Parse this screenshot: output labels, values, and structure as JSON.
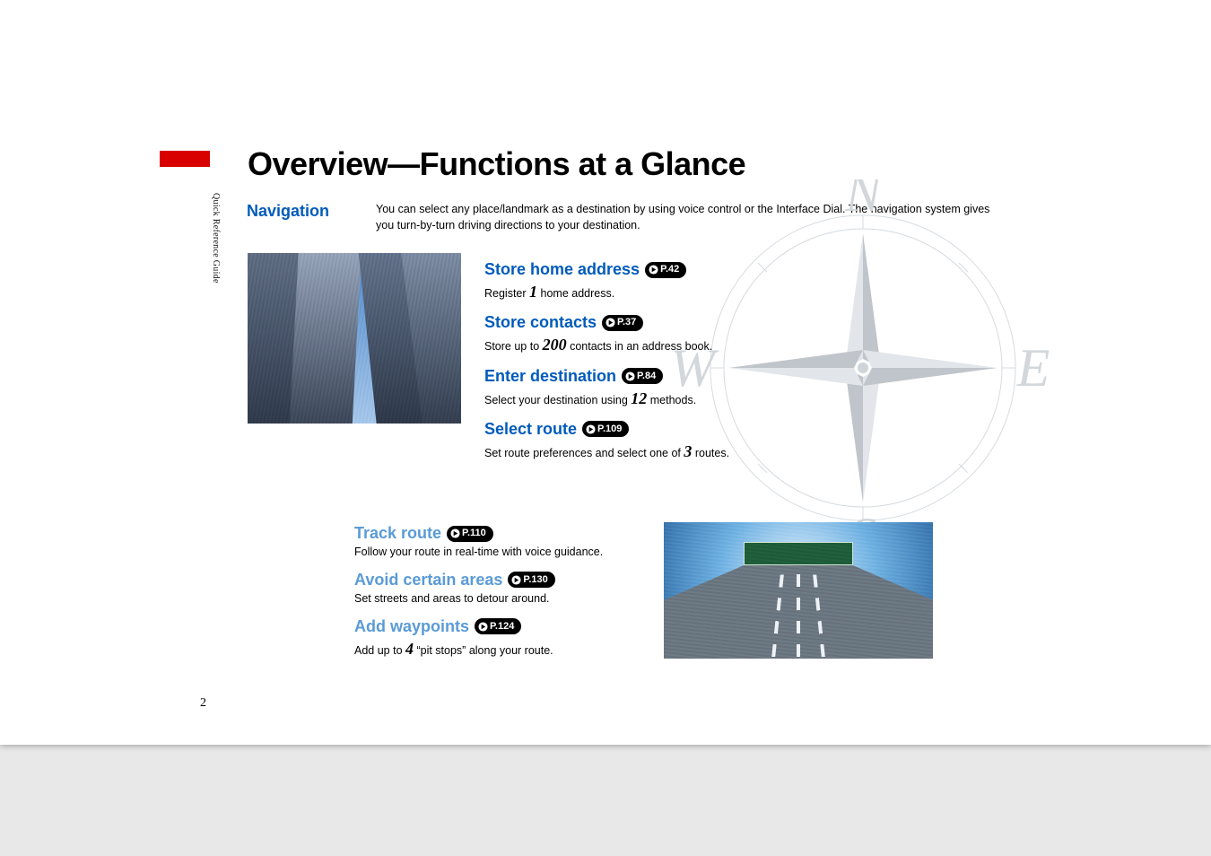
{
  "sidebar_label": "Quick Reference Guide",
  "title": "Overview—Functions at a Glance",
  "subhead": "Navigation",
  "intro": "You can select any place/landmark as a destination by using voice control or the Interface Dial. The navigation system gives you turn-by-turn driving directions to your destination.",
  "group1": [
    {
      "heading": "Store home address",
      "page_ref": "P.42",
      "desc_pre": "Register ",
      "num": "1",
      "desc_post": " home address."
    },
    {
      "heading": "Store contacts",
      "page_ref": "P.37",
      "desc_pre": "Store up to ",
      "num": "200",
      "desc_post": " contacts in an address book."
    },
    {
      "heading": "Enter destination",
      "page_ref": "P.84",
      "desc_pre": "Select your destination using ",
      "num": "12",
      "desc_post": " methods."
    },
    {
      "heading": "Select route",
      "page_ref": "P.109",
      "desc_pre": "Set route preferences and select one of ",
      "num": "3",
      "desc_post": " routes."
    }
  ],
  "group2": [
    {
      "heading": "Track route",
      "page_ref": "P.110",
      "desc": "Follow your route in real-time with voice guidance."
    },
    {
      "heading": "Avoid certain areas",
      "page_ref": "P.130",
      "desc": "Set streets and areas to detour around."
    },
    {
      "heading": "Add waypoints",
      "page_ref": "P.124",
      "desc_pre": "Add up to ",
      "num": "4",
      "desc_post": " “pit stops” along your route."
    }
  ],
  "page_number": "2",
  "compass_cardinals": {
    "n": "N",
    "e": "E",
    "s": "S",
    "w": "W"
  }
}
